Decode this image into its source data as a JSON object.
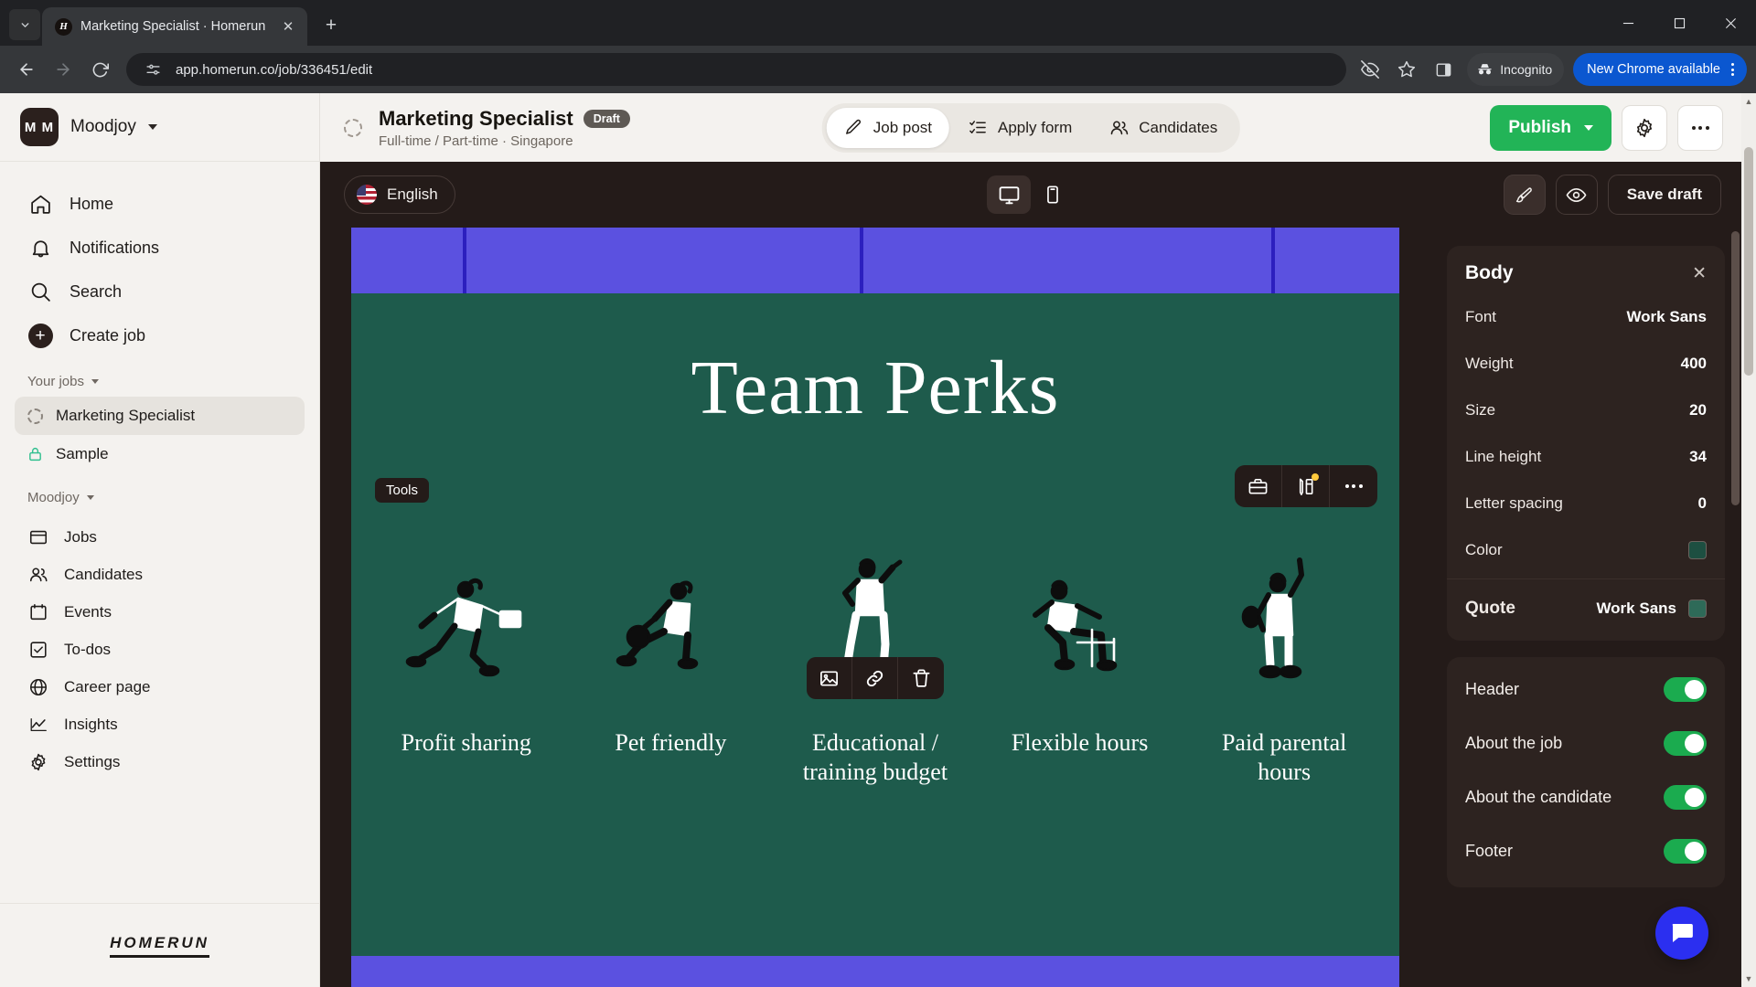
{
  "browser": {
    "tab": {
      "title": "Marketing Specialist · Homerun",
      "favicon_letter": "H",
      "close_label": "✕"
    },
    "new_tab_label": "+",
    "tab_search_icon": "chevron-down-icon",
    "url": "app.homerun.co/job/336451/edit",
    "incognito_label": "Incognito",
    "update_label": "New Chrome available",
    "window": {
      "minimize": "—",
      "maximize": "❐",
      "close": "✕"
    }
  },
  "sidebar": {
    "org": {
      "initials": "M M",
      "name": "Moodjoy"
    },
    "primary": [
      {
        "label": "Home",
        "icon": "home-icon"
      },
      {
        "label": "Notifications",
        "icon": "bell-icon"
      },
      {
        "label": "Search",
        "icon": "search-icon"
      },
      {
        "label": "Create job",
        "icon": "plus-circle-icon"
      }
    ],
    "your_jobs_label": "Your jobs",
    "jobs": [
      {
        "label": "Marketing Specialist",
        "icon": "dashed-circle-icon",
        "active": true
      },
      {
        "label": "Sample",
        "icon": "lock-icon",
        "active": false
      }
    ],
    "workspace_label": "Moodjoy",
    "secondary": [
      {
        "label": "Jobs",
        "icon": "board-icon"
      },
      {
        "label": "Candidates",
        "icon": "people-icon"
      },
      {
        "label": "Events",
        "icon": "calendar-icon"
      },
      {
        "label": "To-dos",
        "icon": "checkbox-icon"
      },
      {
        "label": "Career page",
        "icon": "globe-icon"
      },
      {
        "label": "Insights",
        "icon": "chart-line-icon"
      },
      {
        "label": "Settings",
        "icon": "gear-icon"
      }
    ],
    "brand": "HOMERUN"
  },
  "header": {
    "job_title": "Marketing Specialist",
    "status_badge": "Draft",
    "job_subtitle": "Full-time / Part-time · Singapore",
    "tabs": [
      {
        "label": "Job post",
        "icon": "pencil-icon",
        "active": true
      },
      {
        "label": "Apply form",
        "icon": "checklist-icon",
        "active": false
      },
      {
        "label": "Candidates",
        "icon": "people-icon",
        "active": false
      }
    ],
    "publish_label": "Publish",
    "settings_icon": "gear-icon",
    "more_icon": "ellipsis-icon"
  },
  "editor_bar": {
    "language": "English",
    "language_flag": "us-flag-icon",
    "devices": [
      {
        "name": "desktop-icon",
        "active": true
      },
      {
        "name": "mobile-icon",
        "active": false
      }
    ],
    "brush_icon": "paintbrush-icon",
    "preview_icon": "eye-icon",
    "save_draft_label": "Save draft"
  },
  "canvas": {
    "section_title": "Team Perks",
    "tools_chip": "Tools",
    "block_toolbar": [
      {
        "icon": "toolbox-icon"
      },
      {
        "icon": "style-edit-icon",
        "has_badge": true
      },
      {
        "icon": "ellipsis-icon"
      }
    ],
    "image_toolbar": [
      {
        "icon": "image-icon"
      },
      {
        "icon": "link-icon"
      },
      {
        "icon": "trash-icon"
      }
    ],
    "perks": [
      {
        "label": "Profit sharing",
        "art": "person-running-with-briefcase"
      },
      {
        "label": "Pet friendly",
        "art": "person-kneeling-with-dog"
      },
      {
        "label": "Educational / training budget",
        "art": "person-walking-reading"
      },
      {
        "label": "Flexible hours",
        "art": "person-sitting-on-chair"
      },
      {
        "label": "Paid parental hours",
        "art": "person-standing-arm-raised"
      }
    ],
    "colors": {
      "background": "#1e5b4c",
      "band": "#5b51e0",
      "band_line": "#2c1fbe",
      "text": "#ffffff"
    }
  },
  "panel": {
    "title": "Body",
    "close_label": "✕",
    "rows": [
      {
        "key": "Font",
        "value": "Work Sans"
      },
      {
        "key": "Weight",
        "value": "400"
      },
      {
        "key": "Size",
        "value": "20"
      },
      {
        "key": "Line height",
        "value": "34"
      },
      {
        "key": "Letter spacing",
        "value": "0"
      }
    ],
    "color_row": {
      "key": "Color",
      "swatch": "#1d4f41"
    },
    "quote_row": {
      "key": "Quote",
      "value": "Work Sans",
      "swatch": "#2e6a58"
    },
    "toggles": [
      {
        "label": "Header",
        "on": true
      },
      {
        "label": "About the job",
        "on": true
      },
      {
        "label": "About the candidate",
        "on": true
      },
      {
        "label": "Footer",
        "on": true
      }
    ],
    "toggle_color": "#1bab4f"
  }
}
